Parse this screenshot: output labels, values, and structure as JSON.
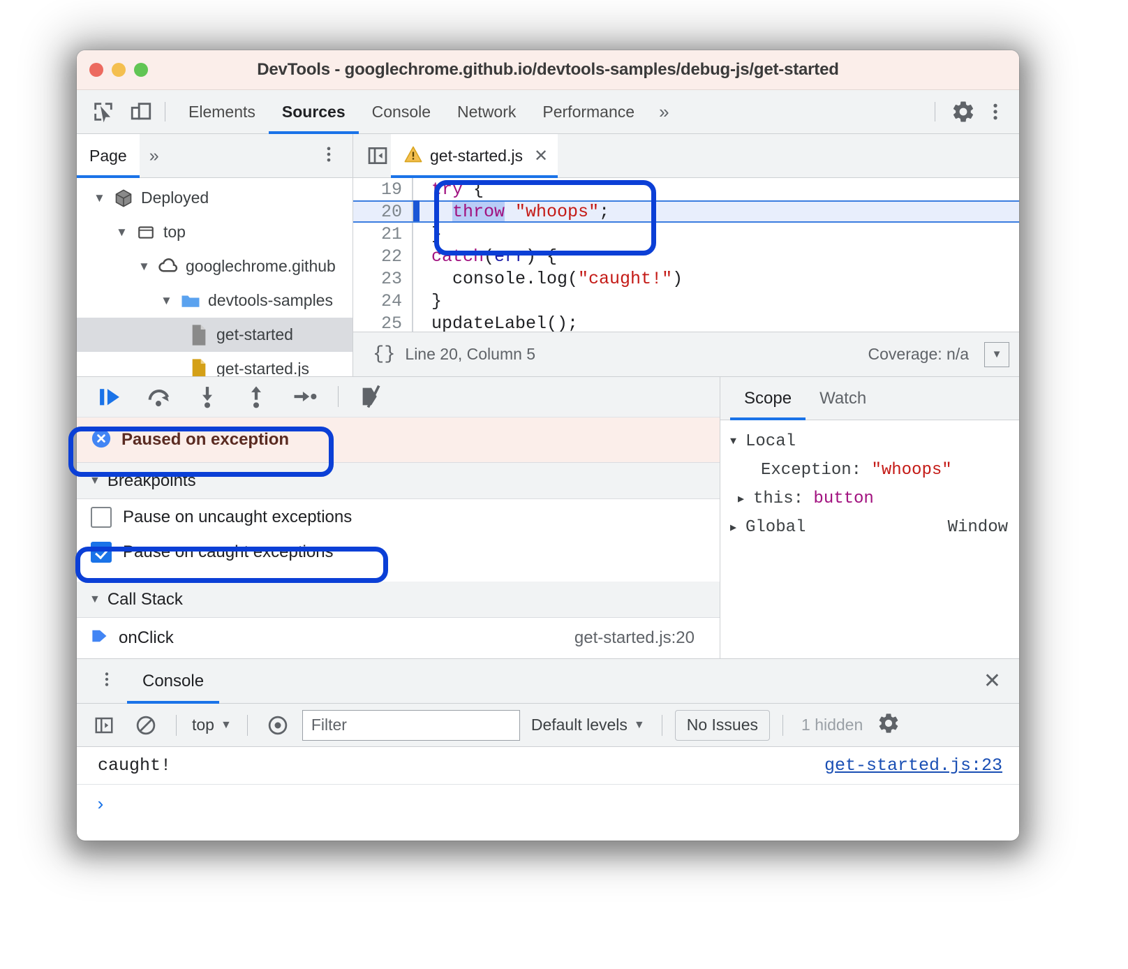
{
  "window": {
    "title": "DevTools - googlechrome.github.io/devtools-samples/debug-js/get-started"
  },
  "toolbar": {
    "inspect_icon": "inspect-element-icon",
    "device_icon": "device-toolbar-icon",
    "tabs": [
      {
        "label": "Elements",
        "active": false
      },
      {
        "label": "Sources",
        "active": true
      },
      {
        "label": "Console",
        "active": false
      },
      {
        "label": "Network",
        "active": false
      },
      {
        "label": "Performance",
        "active": false
      }
    ],
    "more_label": "»",
    "settings_icon": "gear-icon",
    "menu_icon": "kebab-menu-icon"
  },
  "navigator": {
    "tab_label": "Page",
    "more_label": "»",
    "menu_icon": "kebab-menu-icon",
    "tree": [
      {
        "label": "Deployed",
        "icon": "cube-icon",
        "depth": 0,
        "expanded": true,
        "selected": false
      },
      {
        "label": "top",
        "icon": "frame-icon",
        "depth": 1,
        "expanded": true,
        "selected": false
      },
      {
        "label": "googlechrome.github",
        "icon": "cloud-icon",
        "depth": 2,
        "expanded": true,
        "selected": false
      },
      {
        "label": "devtools-samples",
        "icon": "folder-icon",
        "depth": 3,
        "expanded": true,
        "selected": false
      },
      {
        "label": "get-started",
        "icon": "document-icon",
        "depth": 4,
        "expanded": false,
        "selected": true
      },
      {
        "label": "get-started.js",
        "icon": "script-icon",
        "depth": 4,
        "expanded": false,
        "selected": false
      }
    ]
  },
  "editor": {
    "sidebar_toggle_icon": "show-navigator-icon",
    "warning_icon": "warning-triangle-icon",
    "tab_name": "get-started.js",
    "close_icon": "close-icon",
    "lines": [
      {
        "num": "19",
        "current": false,
        "tokens": [
          {
            "t": "try",
            "c": "kw"
          },
          {
            "t": " {",
            "c": ""
          }
        ]
      },
      {
        "num": "20",
        "current": true,
        "tokens": [
          {
            "t": "  ",
            "c": ""
          },
          {
            "t": "throw",
            "c": "kw hl"
          },
          {
            "t": " ",
            "c": ""
          },
          {
            "t": "\"whoops\"",
            "c": "str"
          },
          {
            "t": ";",
            "c": ""
          }
        ]
      },
      {
        "num": "21",
        "current": false,
        "tokens": [
          {
            "t": "}",
            "c": ""
          }
        ]
      },
      {
        "num": "22",
        "current": false,
        "tokens": [
          {
            "t": "catch",
            "c": "kw"
          },
          {
            "t": "(",
            "c": ""
          },
          {
            "t": "err",
            "c": "var"
          },
          {
            "t": ") {",
            "c": ""
          }
        ]
      },
      {
        "num": "23",
        "current": false,
        "tokens": [
          {
            "t": "  console.log(",
            "c": ""
          },
          {
            "t": "\"caught!\"",
            "c": "str"
          },
          {
            "t": ")",
            "c": ""
          }
        ]
      },
      {
        "num": "24",
        "current": false,
        "tokens": [
          {
            "t": "}",
            "c": ""
          }
        ]
      },
      {
        "num": "25",
        "current": false,
        "tokens": [
          {
            "t": "updateLabel();",
            "c": ""
          }
        ]
      }
    ],
    "status": {
      "format_icon": "pretty-print-braces-icon",
      "position": "Line 20, Column 5",
      "coverage": "Coverage: n/a",
      "coverage_toggle_icon": "coverage-drawer-icon"
    }
  },
  "debugger": {
    "buttons": [
      {
        "name": "resume-script-execution",
        "icon": "resume-icon"
      },
      {
        "name": "step-over-next-function-call",
        "icon": "step-over-icon"
      },
      {
        "name": "step-into-next-function-call",
        "icon": "step-into-icon"
      },
      {
        "name": "step-out-of-current-function",
        "icon": "step-out-icon"
      },
      {
        "name": "step",
        "icon": "step-icon"
      },
      {
        "name": "deactivate-breakpoints",
        "icon": "deactivate-breakpoints-icon"
      }
    ],
    "paused": {
      "icon": "pause-exception-icon",
      "text": "Paused on exception"
    },
    "breakpoints": {
      "title": "Breakpoints",
      "expanded": true,
      "items": [
        {
          "label": "Pause on uncaught exceptions",
          "checked": false
        },
        {
          "label": "Pause on caught exceptions",
          "checked": true
        }
      ]
    },
    "call_stack": {
      "title": "Call Stack",
      "expanded": true,
      "frames": [
        {
          "icon": "current-frame-arrow-icon",
          "name": "onClick",
          "location": "get-started.js:20"
        }
      ]
    }
  },
  "scope": {
    "tabs": [
      {
        "label": "Scope",
        "active": true
      },
      {
        "label": "Watch",
        "active": false
      }
    ],
    "rows": [
      {
        "indent": 0,
        "tri": "▼",
        "name": "Local",
        "sep": "",
        "value": "",
        "value_class": "",
        "right": ""
      },
      {
        "indent": 1,
        "tri": "",
        "name": "Exception:",
        "sep": " ",
        "value": "\"whoops\"",
        "value_class": "sc-val-str",
        "right": ""
      },
      {
        "indent": 0,
        "tri": "▶",
        "name": "this:",
        "sep": " ",
        "value": "button",
        "value_class": "sc-val-obj",
        "right": ""
      },
      {
        "indent": 0,
        "tri": "▶",
        "name": "Global",
        "sep": "",
        "value": "",
        "value_class": "",
        "right": "Window"
      }
    ]
  },
  "drawer": {
    "menu_icon": "kebab-menu-icon",
    "tab_label": "Console",
    "close_icon": "close-icon",
    "toolbar": {
      "sidebar_icon": "console-sidebar-icon",
      "clear_icon": "clear-console-icon",
      "context": "top",
      "context_caret": "▼",
      "eye_icon": "live-expression-icon",
      "filter_placeholder": "Filter",
      "filter_value": "",
      "levels_label": "Default levels",
      "levels_caret": "▼",
      "issues_label": "No Issues",
      "hidden_label": "1 hidden",
      "settings_icon": "gear-icon"
    },
    "messages": [
      {
        "text": "caught!",
        "source": "get-started.js:23"
      }
    ],
    "prompt": "›"
  },
  "colors": {
    "accent": "#1a73e8",
    "annotation": "#0b3fd6",
    "paused_bg": "#fbeeea",
    "paused_text": "#5a2b22",
    "string": "#c41a16",
    "keyword": "#a1117f"
  }
}
